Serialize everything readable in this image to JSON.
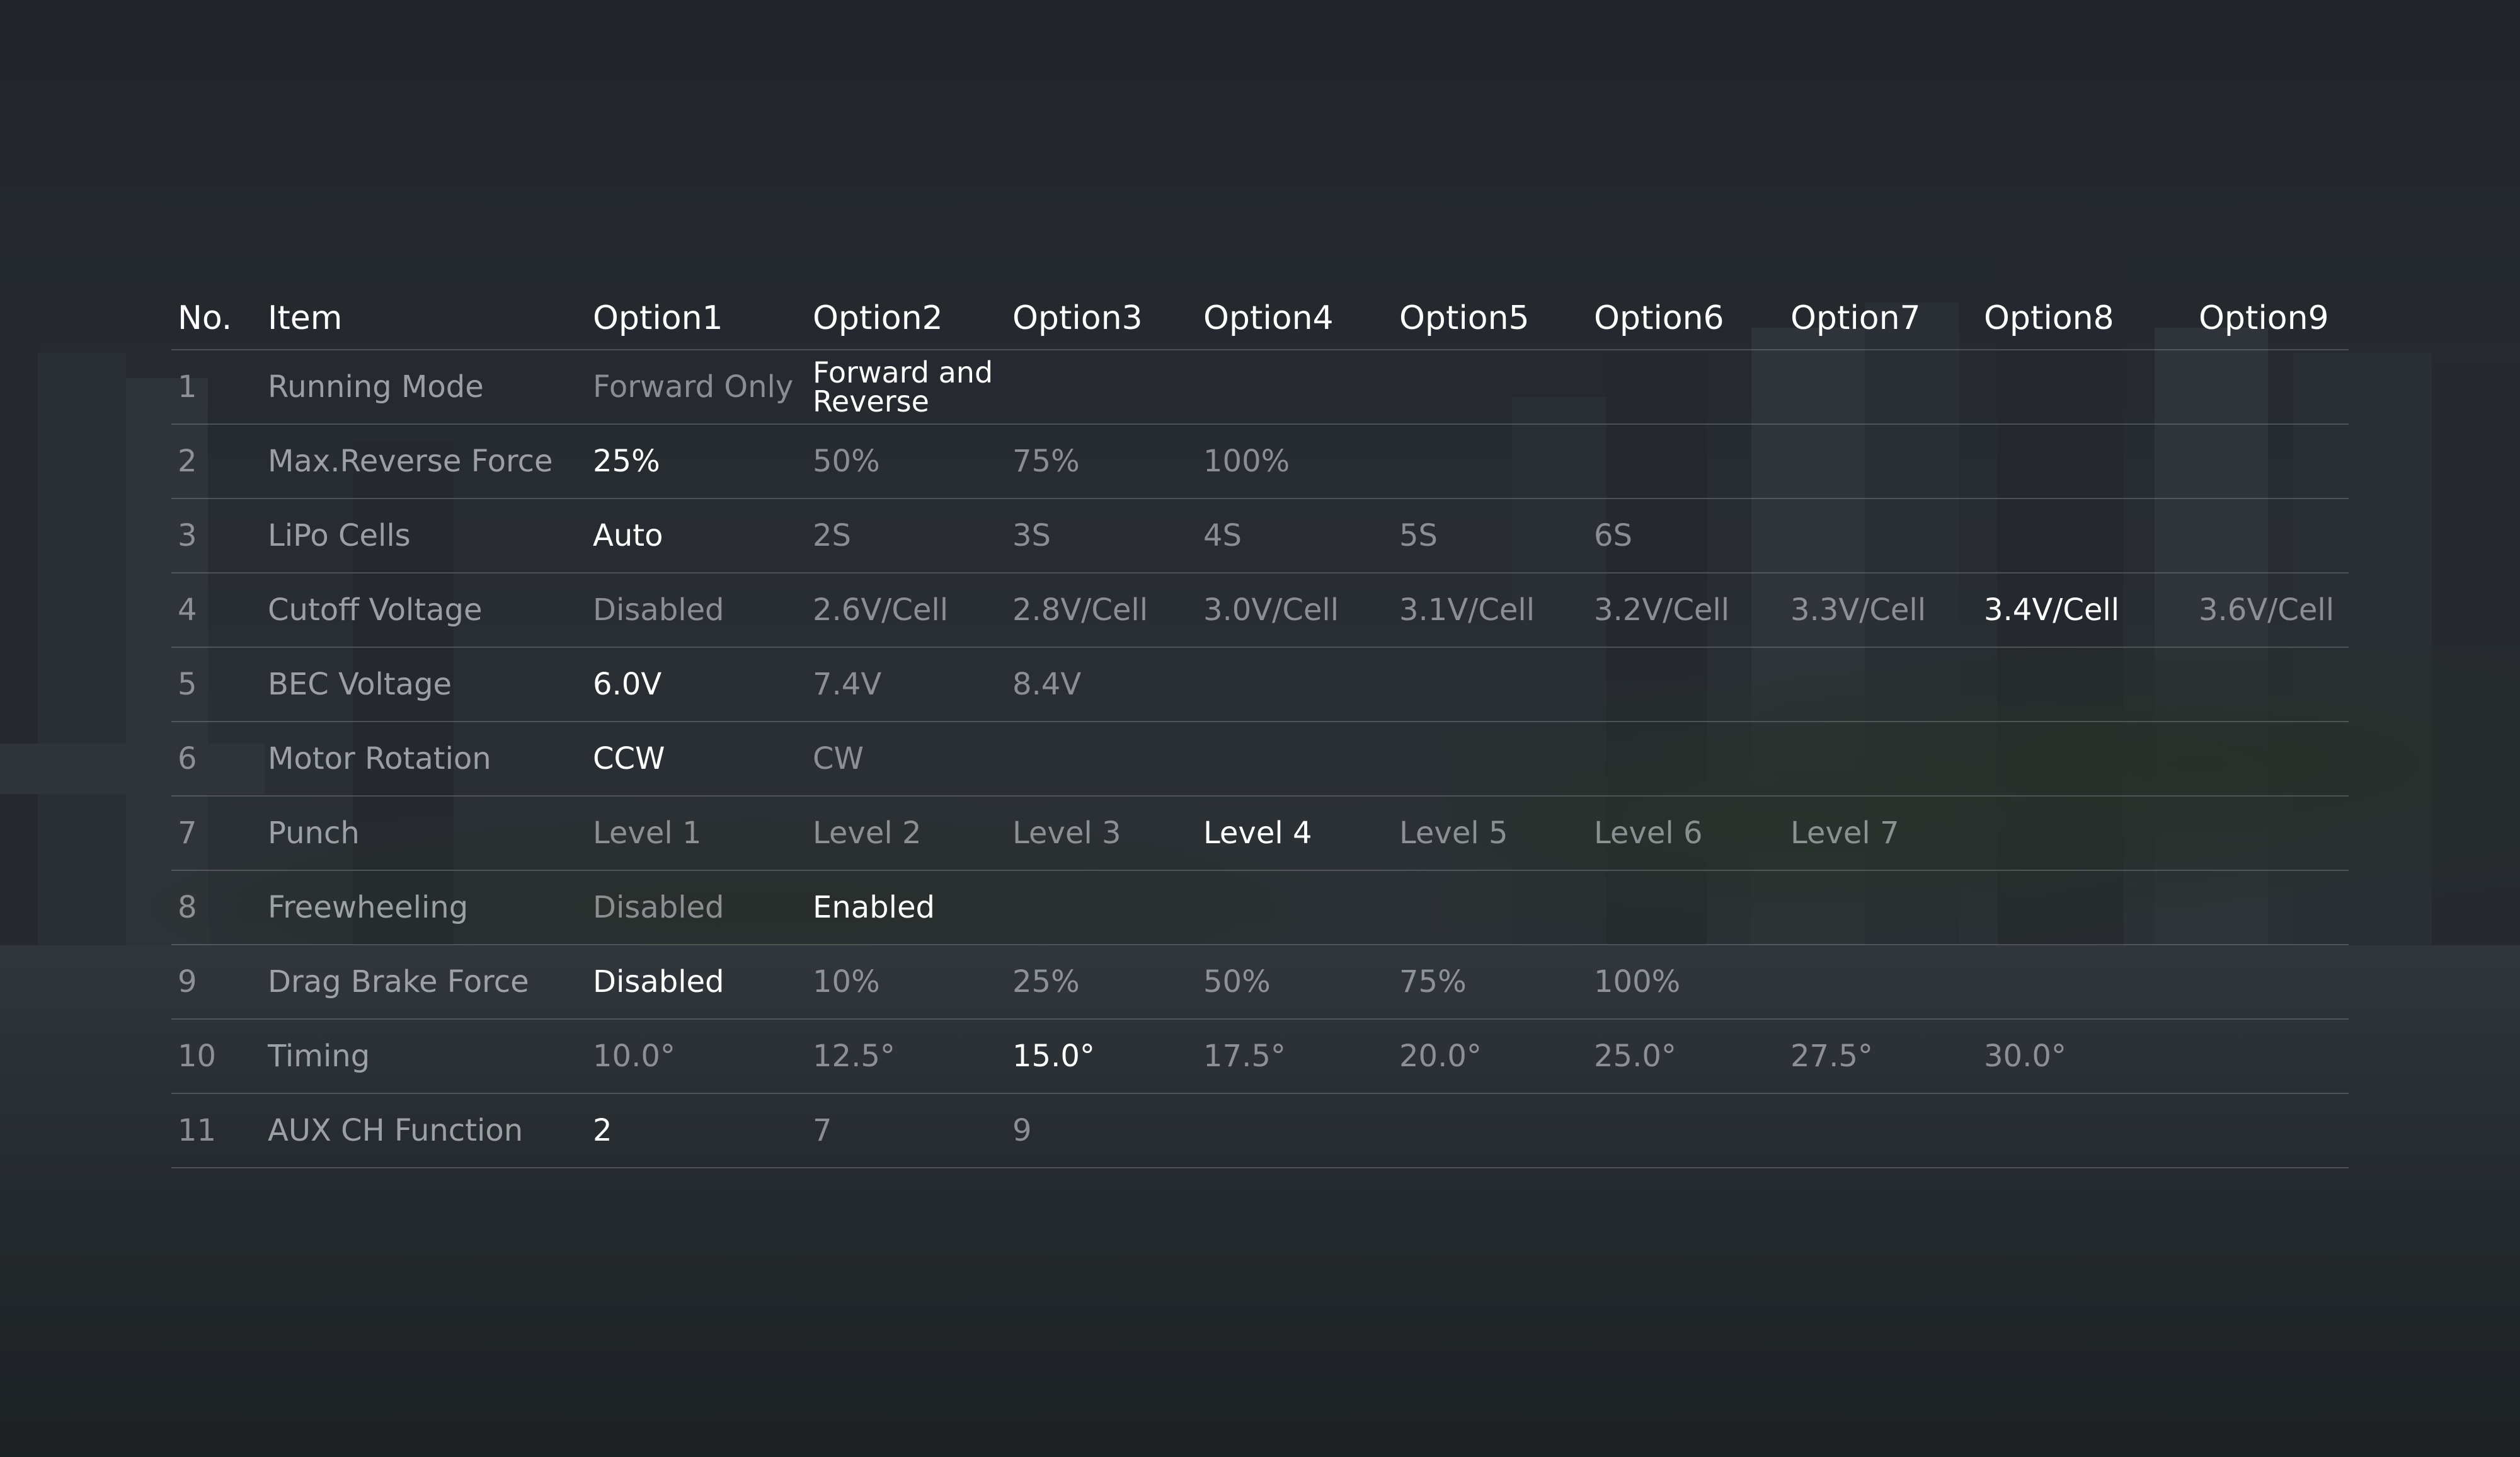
{
  "table": {
    "headers": [
      "No.",
      "Item",
      "Option1",
      "Option2",
      "Option3",
      "Option4",
      "Option5",
      "Option6",
      "Option7",
      "Option8",
      "Option9"
    ],
    "rows": [
      {
        "no": "1",
        "item": "Running Mode",
        "options": [
          "Forward Only",
          "Forward and Reverse",
          "",
          "",
          "",
          "",
          "",
          "",
          ""
        ],
        "selected_option": 2
      },
      {
        "no": "2",
        "item": "Max.Reverse Force",
        "options": [
          "25%",
          "50%",
          "75%",
          "100%",
          "",
          "",
          "",
          "",
          ""
        ],
        "selected_option": 1
      },
      {
        "no": "3",
        "item": "LiPo Cells",
        "options": [
          "Auto",
          "2S",
          "3S",
          "4S",
          "5S",
          "6S",
          "",
          "",
          ""
        ],
        "selected_option": 1
      },
      {
        "no": "4",
        "item": "Cutoff Voltage",
        "options": [
          "Disabled",
          "2.6V/Cell",
          "2.8V/Cell",
          "3.0V/Cell",
          "3.1V/Cell",
          "3.2V/Cell",
          "3.3V/Cell",
          "3.4V/Cell",
          "3.6V/Cell"
        ],
        "selected_option": 8
      },
      {
        "no": "5",
        "item": "BEC Voltage",
        "options": [
          "6.0V",
          "7.4V",
          "8.4V",
          "",
          "",
          "",
          "",
          "",
          ""
        ],
        "selected_option": 1
      },
      {
        "no": "6",
        "item": "Motor Rotation",
        "options": [
          "CCW",
          "CW",
          "",
          "",
          "",
          "",
          "",
          "",
          ""
        ],
        "selected_option": 1
      },
      {
        "no": "7",
        "item": "Punch",
        "options": [
          "Level 1",
          "Level 2",
          "Level 3",
          "Level 4",
          "Level 5",
          "Level 6",
          "Level 7",
          "",
          ""
        ],
        "selected_option": 4
      },
      {
        "no": "8",
        "item": "Freewheeling",
        "options": [
          "Disabled",
          "Enabled",
          "",
          "",
          "",
          "",
          "",
          "",
          ""
        ],
        "selected_option": 2
      },
      {
        "no": "9",
        "item": "Drag Brake Force",
        "options": [
          "Disabled",
          "10%",
          "25%",
          "50%",
          "75%",
          "100%",
          "",
          "",
          ""
        ],
        "selected_option": 1
      },
      {
        "no": "10",
        "item": "Timing",
        "options": [
          "10.0°",
          "12.5°",
          "15.0°",
          "17.5°",
          "20.0°",
          "25.0°",
          "27.5°",
          "30.0°",
          ""
        ],
        "selected_option": 3
      },
      {
        "no": "11",
        "item": "AUX CH Function",
        "options": [
          "2",
          "7",
          "9",
          "",
          "",
          "",
          "",
          "",
          ""
        ],
        "selected_option": 1
      }
    ]
  },
  "colors": {
    "selected_text": "#ffffff",
    "unselected_text": "#a8acb0",
    "divider": "#5f6367"
  }
}
